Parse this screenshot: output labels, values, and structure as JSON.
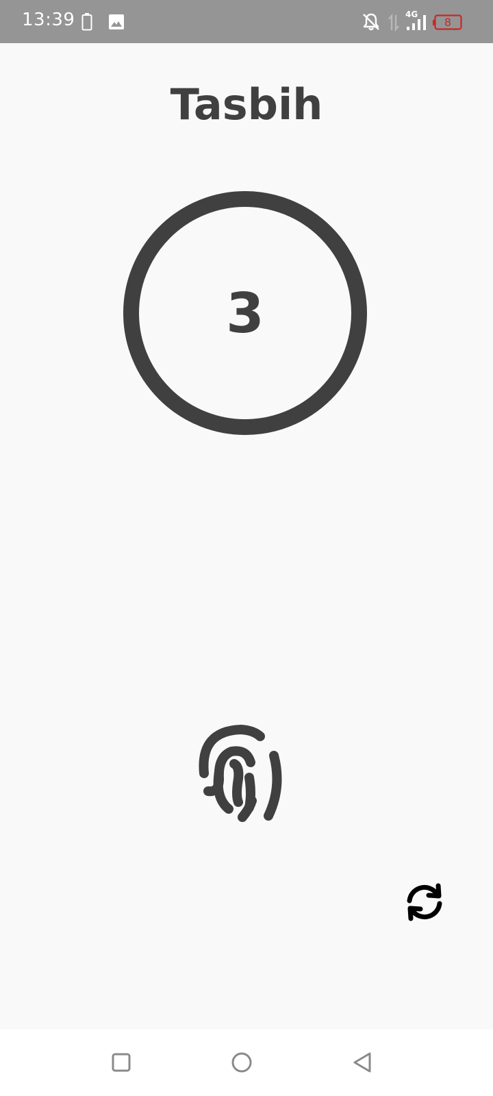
{
  "status_bar": {
    "time": "13:39",
    "network": "4G",
    "battery_level": "8",
    "icons": [
      "battery-icon",
      "image-icon",
      "notifications-off-icon",
      "data-arrows-icon",
      "signal-icon",
      "battery-low-icon"
    ]
  },
  "app": {
    "title": "Tasbih",
    "counter": "3",
    "colors": {
      "ring": "#404040",
      "text": "#404040",
      "background": "#f9f9f9",
      "status_bar": "#959595",
      "battery_low": "#c62828"
    },
    "icons": {
      "tap": "fingerprint-icon",
      "reset": "refresh-icon"
    }
  },
  "nav_bar": {
    "icons": [
      "recents-icon",
      "home-icon",
      "back-icon"
    ]
  }
}
